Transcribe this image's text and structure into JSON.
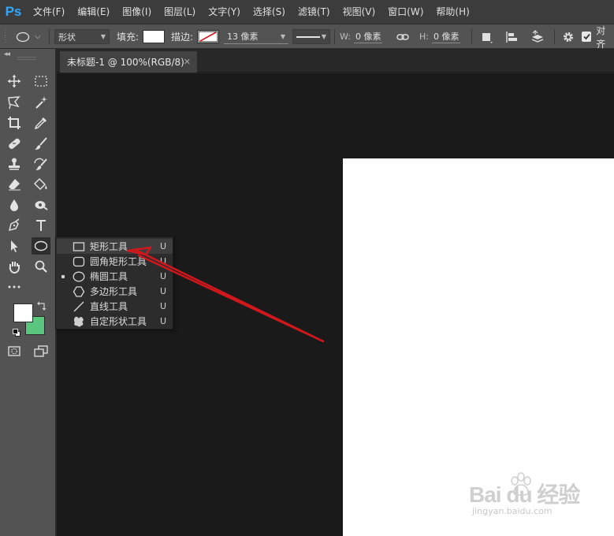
{
  "app": {
    "logo": "Ps",
    "accent": "#31a8ff"
  },
  "menubar": {
    "items": [
      "文件(F)",
      "编辑(E)",
      "图像(I)",
      "图层(L)",
      "文字(Y)",
      "选择(S)",
      "滤镜(T)",
      "视图(V)",
      "窗口(W)",
      "帮助(H)"
    ]
  },
  "options": {
    "tool_preset_icon": "ellipse-icon",
    "mode_value": "形状",
    "fill_label": "填充:",
    "fill_color": "#ffffff",
    "stroke_label": "描边:",
    "stroke_size": "13 像素",
    "w_label": "W:",
    "w_value": "0 像素",
    "h_label": "H:",
    "h_value": "0 像素",
    "align_edges_label": "对齐"
  },
  "document": {
    "tab_title": "未标题-1 @ 100%(RGB/8)",
    "canvas_color": "#ffffff",
    "workspace_color": "#1a1a1a"
  },
  "toolbar": {
    "foreground_color": "#ffffff",
    "background_color": "#5ac57d"
  },
  "flyout": {
    "items": [
      {
        "label": "矩形工具",
        "key": "U",
        "icon": "rectangle-icon",
        "hover": true,
        "selected": false
      },
      {
        "label": "圆角矩形工具",
        "key": "U",
        "icon": "rounded-rectangle-icon",
        "hover": false,
        "selected": false
      },
      {
        "label": "椭圆工具",
        "key": "U",
        "icon": "ellipse-icon",
        "hover": false,
        "selected": true
      },
      {
        "label": "多边形工具",
        "key": "U",
        "icon": "polygon-icon",
        "hover": false,
        "selected": false
      },
      {
        "label": "直线工具",
        "key": "U",
        "icon": "line-icon",
        "hover": false,
        "selected": false
      },
      {
        "label": "自定形状工具",
        "key": "U",
        "icon": "custom-shape-icon",
        "hover": false,
        "selected": false
      }
    ]
  },
  "annotation": {
    "arrow_color": "#d0171b"
  },
  "watermark": {
    "brand": "Bai du 经验",
    "url": "jingyan.baidu.com"
  }
}
